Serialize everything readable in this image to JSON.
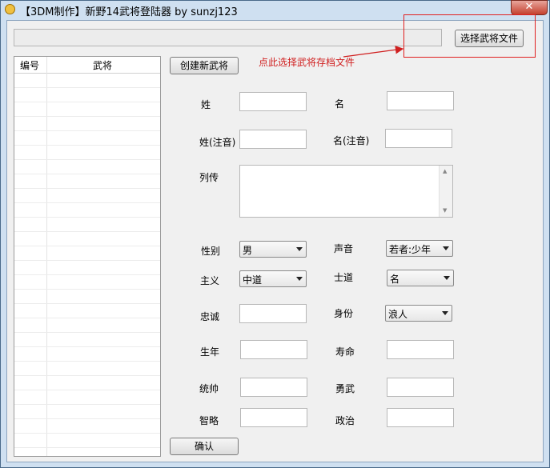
{
  "window": {
    "title": "【3DM制作】新野14武将登陆器 by sunzj123",
    "close_glyph": "✕"
  },
  "toolbar": {
    "select_file_label": "选择武将文件",
    "hint_text": "点此选择武将存档文件",
    "create_label": "创建新武将",
    "confirm_label": "确认"
  },
  "list": {
    "columns": [
      "编号",
      "武将"
    ]
  },
  "form": {
    "surname_label": "姓",
    "given_name_label": "名",
    "surname_reading_label": "姓(注音)",
    "given_name_reading_label": "名(注音)",
    "biography_label": "列传",
    "gender_label": "性别",
    "gender_value": "男",
    "voice_label": "声音",
    "voice_value": "若者:少年",
    "ideology_label": "主义",
    "ideology_value": "中道",
    "code_label": "士道",
    "code_value": "名",
    "loyalty_label": "忠诚",
    "status_label": "身份",
    "status_value": "浪人",
    "birth_year_label": "生年",
    "lifespan_label": "寿命",
    "leadership_label": "统帅",
    "valor_label": "勇武",
    "intellect_label": "智略",
    "politics_label": "政治"
  },
  "colors": {
    "hint_red": "#d02020",
    "window_frame": "#cfe0f1",
    "client_bg": "#f0f0f0"
  }
}
